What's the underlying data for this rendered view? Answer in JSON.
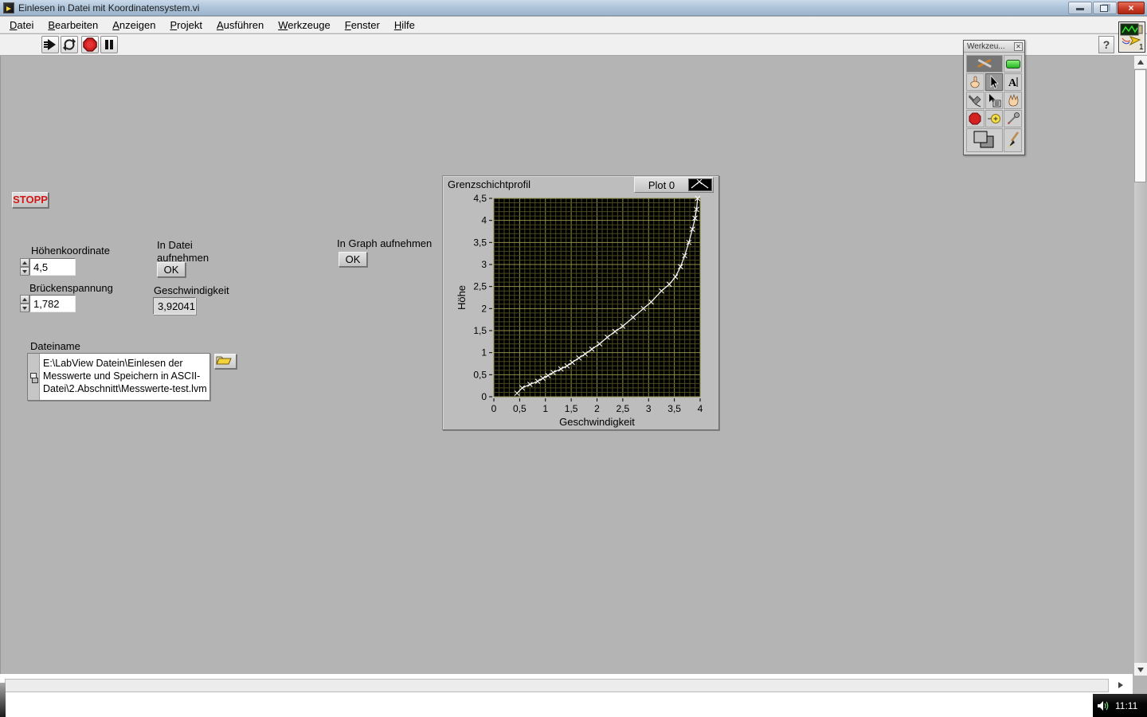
{
  "window": {
    "title": "Einlesen in Datei mit Koordinatensystem.vi",
    "controls": [
      "minimize",
      "restore",
      "close"
    ]
  },
  "menu": {
    "items": [
      {
        "label": "Datei"
      },
      {
        "label": "Bearbeiten"
      },
      {
        "label": "Anzeigen"
      },
      {
        "label": "Projekt"
      },
      {
        "label": "Ausführen"
      },
      {
        "label": "Werkzeuge"
      },
      {
        "label": "Fenster"
      },
      {
        "label": "Hilfe"
      }
    ]
  },
  "toolbar": {
    "buttons": [
      "run-icon",
      "run-continuous-icon",
      "abort-icon",
      "pause-icon"
    ],
    "help_label": "?"
  },
  "panel": {
    "stop_button": "STOPP",
    "hoehenkoordinate": {
      "label": "Höhenkoordinate",
      "value": "4,5"
    },
    "brueckenspannung": {
      "label": "Brückenspannung",
      "value": "1,782"
    },
    "in_datei": {
      "label": "In Datei aufnehmen",
      "button": "OK"
    },
    "geschwindigkeit": {
      "label": "Geschwindigkeit",
      "value": "3,92041"
    },
    "in_graph": {
      "label": "In Graph aufnehmen",
      "button": "OK"
    },
    "dateiname": {
      "label": "Dateiname",
      "path": "E:\\LabView Datein\\Einlesen der Messwerte und Speichern in ASCII-Datei\\2.Abschnitt\\Messwerte-test.lvm"
    }
  },
  "tools_palette": {
    "title": "Werkzeu...",
    "tools": [
      "auto-tool-select",
      "led-indicator",
      "operate-value",
      "position-select",
      "edit-text",
      "connect-wire",
      "object-shortcut-menu",
      "scroll-window",
      "breakpoint",
      "probe",
      "get-color",
      "set-color",
      "paint-brush"
    ]
  },
  "graph": {
    "title": "Grenzschichtprofil",
    "legend_label": "Plot 0",
    "xlabel": "Geschwindigkeit",
    "ylabel": "Höhe"
  },
  "chart_data": {
    "type": "line",
    "title": "Grenzschichtprofil",
    "xlabel": "Geschwindigkeit",
    "ylabel": "Höhe",
    "xlim": [
      0,
      4
    ],
    "ylim": [
      0,
      4.5
    ],
    "x_ticks": [
      0,
      0.5,
      1,
      1.5,
      2,
      2.5,
      3,
      3.5,
      4
    ],
    "y_ticks": [
      0,
      0.5,
      1,
      1.5,
      2,
      2.5,
      3,
      3.5,
      4,
      4.5
    ],
    "decimal_separator": ",",
    "grid": {
      "minor_step": 0.1,
      "major_step": 0.5,
      "minor_color": "#4a4a1f",
      "major_color": "#8f8f48",
      "bg": "#000000"
    },
    "legend_position": "top-right",
    "series": [
      {
        "name": "Plot 0",
        "color": "#ffffff",
        "marker": "x",
        "points": [
          [
            0.45,
            0.08
          ],
          [
            0.55,
            0.2
          ],
          [
            0.7,
            0.28
          ],
          [
            0.85,
            0.35
          ],
          [
            0.95,
            0.42
          ],
          [
            1.05,
            0.48
          ],
          [
            1.15,
            0.55
          ],
          [
            1.3,
            0.63
          ],
          [
            1.42,
            0.7
          ],
          [
            1.52,
            0.78
          ],
          [
            1.65,
            0.88
          ],
          [
            1.77,
            0.97
          ],
          [
            1.9,
            1.08
          ],
          [
            2.05,
            1.2
          ],
          [
            2.2,
            1.35
          ],
          [
            2.35,
            1.48
          ],
          [
            2.5,
            1.6
          ],
          [
            2.7,
            1.8
          ],
          [
            2.9,
            2.0
          ],
          [
            3.05,
            2.15
          ],
          [
            3.25,
            2.4
          ],
          [
            3.4,
            2.55
          ],
          [
            3.52,
            2.72
          ],
          [
            3.62,
            2.95
          ],
          [
            3.7,
            3.2
          ],
          [
            3.78,
            3.5
          ],
          [
            3.85,
            3.8
          ],
          [
            3.9,
            4.05
          ],
          [
            3.93,
            4.25
          ],
          [
            3.95,
            4.5
          ]
        ]
      }
    ]
  },
  "taskbar": {
    "time": "11:11"
  },
  "colors": {
    "panel_gray": "#b4b4b4",
    "plot_bg": "#000000",
    "grid_major": "#8f8f48",
    "grid_minor": "#4a4a1f",
    "plot_line": "#ffffff",
    "stop_text": "#d01818",
    "led_green": "#3ddc3d",
    "titlebar": "#a9c0d6",
    "close_red": "#c93a24"
  }
}
